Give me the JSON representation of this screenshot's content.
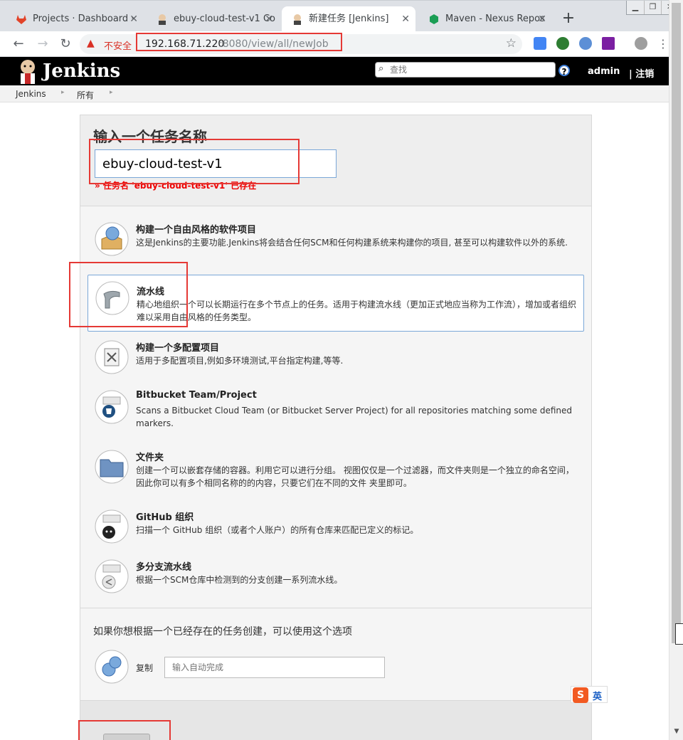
{
  "browser": {
    "tabs": [
      {
        "title": "Projects · Dashboard ·"
      },
      {
        "title": "ebuy-cloud-test-v1 Co"
      },
      {
        "title": "新建任务 [Jenkins]"
      },
      {
        "title": "Maven - Nexus Repos"
      }
    ],
    "insecure_label": "不安全",
    "url_host": "192.168.71.220",
    "url_path": ":8080/view/all/newJob"
  },
  "jenkins": {
    "brand": "Jenkins",
    "search_placeholder": "查找",
    "help": "?",
    "user": "admin",
    "logout": "| 注销"
  },
  "breadcrumb": {
    "items": [
      "Jenkins",
      "所有"
    ]
  },
  "new_job": {
    "heading": "输入一个任务名称",
    "job_name": "ebuy-cloud-test-v1",
    "error": "» 任务名 'ebuy-cloud-test-v1' 已存在"
  },
  "job_types": [
    {
      "name": "构建一个自由风格的软件项目",
      "desc": "这是Jenkins的主要功能.Jenkins将会结合任何SCM和任何构建系统来构建你的项目, 甚至可以构建软件以外的系统."
    },
    {
      "name": "流水线",
      "desc": "精心地组织一个可以长期运行在多个节点上的任务。适用于构建流水线（更加正式地应当称为工作流），增加或者组织难以采用自由风格的任务类型。"
    },
    {
      "name": "构建一个多配置项目",
      "desc": "适用于多配置项目,例如多环境测试,平台指定构建,等等."
    },
    {
      "name": "Bitbucket Team/Project",
      "desc": "Scans a Bitbucket Cloud Team (or Bitbucket Server Project) for all repositories matching some defined markers."
    },
    {
      "name": "文件夹",
      "desc": "创建一个可以嵌套存储的容器。利用它可以进行分组。 视图仅仅是一个过滤器，而文件夹则是一个独立的命名空间， 因此你可以有多个相同名称的的内容，只要它们在不同的文件 夹里即可。"
    },
    {
      "name": "GitHub 组织",
      "desc": "扫描一个 GitHub 组织（或者个人账户）的所有仓库来匹配已定义的标记。"
    },
    {
      "name": "多分支流水线",
      "desc": "根据一个SCM仓库中检测到的分支创建一系列流水线。"
    }
  ],
  "copy": {
    "title": "如果你想根据一个已经存在的任务创建，可以使用这个选项",
    "label": "复制",
    "placeholder": "输入自动完成"
  },
  "ime": {
    "s": "S",
    "lang": "英"
  }
}
